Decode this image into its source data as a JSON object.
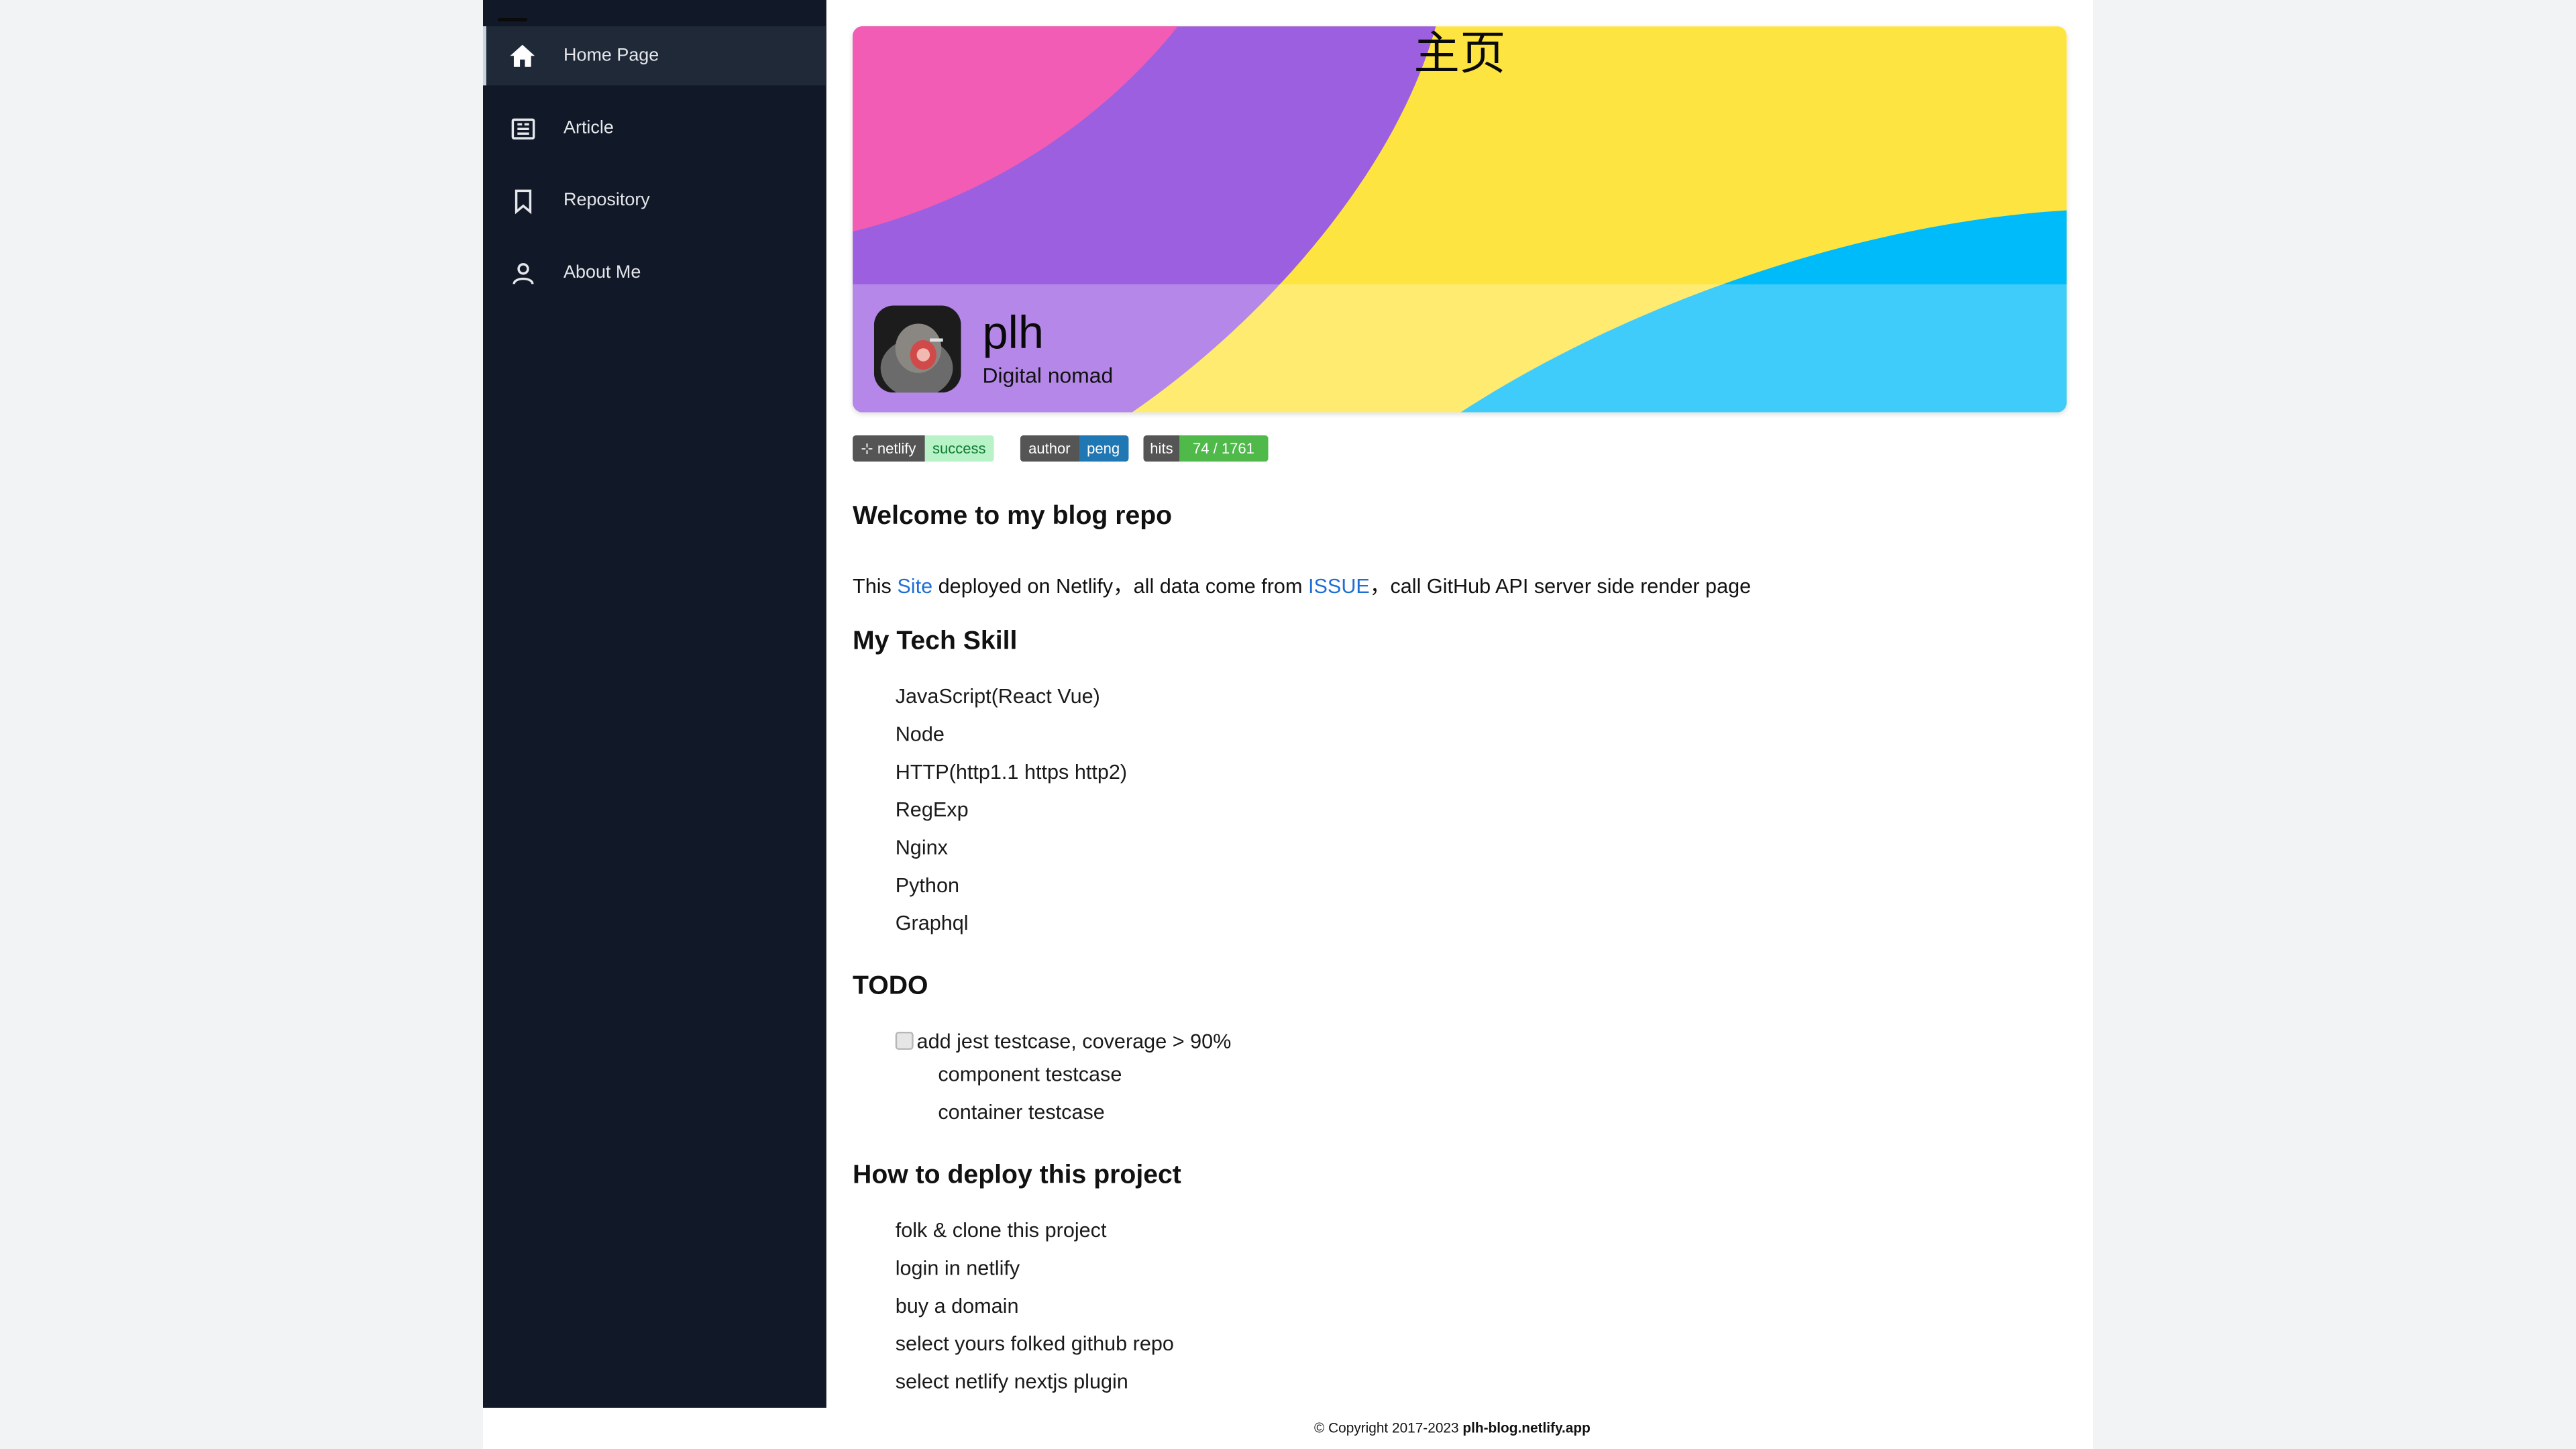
{
  "nav": {
    "items": [
      {
        "label": "Home Page",
        "icon": "home-icon",
        "active": true
      },
      {
        "label": "Article",
        "icon": "newspaper-icon",
        "active": false
      },
      {
        "label": "Repository",
        "icon": "bookmark-icon",
        "active": false
      },
      {
        "label": "About Me",
        "icon": "person-icon",
        "active": false
      }
    ]
  },
  "banner": {
    "title": "主页",
    "name": "plh",
    "bio": "Digital nomad",
    "colors": {
      "pink": "#f25cb5",
      "purple": "#9b5fe0",
      "yellow": "#fee440",
      "blue": "#00bbf9"
    }
  },
  "badges": [
    {
      "left": "⊹ netlify",
      "right": "success",
      "left_color": "#555555",
      "right_color": "#b7f3c6",
      "right_text_color": "#0e7b33"
    },
    {
      "left": "author",
      "right": "peng",
      "left_color": "#555555",
      "right_color": "#1f77b4",
      "right_text_color": "#ffffff"
    },
    {
      "left": "hits",
      "right": "74 / 1761",
      "left_color": "#555555",
      "right_color": "#4fb94a",
      "right_text_color": "#ffffff"
    }
  ],
  "intro": {
    "heading": "Welcome to my blog repo",
    "text_1": "This ",
    "link_site": "Site",
    "text_2": " deployed on Netlify，all data come from ",
    "link_issue": "ISSUE",
    "text_3": "，call GitHub API server side render page"
  },
  "skills": {
    "heading": "My Tech Skill",
    "items": [
      "JavaScript(React Vue)",
      "Node",
      "HTTP(http1.1 https http2)",
      "RegExp",
      "Nginx",
      "Python",
      "Graphql"
    ]
  },
  "todo": {
    "heading": "TODO",
    "main": "add jest testcase, coverage > 90%",
    "checked": true,
    "sub": [
      "component testcase",
      "container testcase"
    ]
  },
  "deploy": {
    "heading": "How to deploy this project",
    "items": [
      "folk & clone this project",
      "login in netlify",
      "buy a domain",
      "select yours folked github repo",
      "select netlify nextjs plugin"
    ]
  },
  "footer": {
    "copyright": "© Copyright  2017-2023",
    "site": "plh-blog.netlify.app"
  }
}
